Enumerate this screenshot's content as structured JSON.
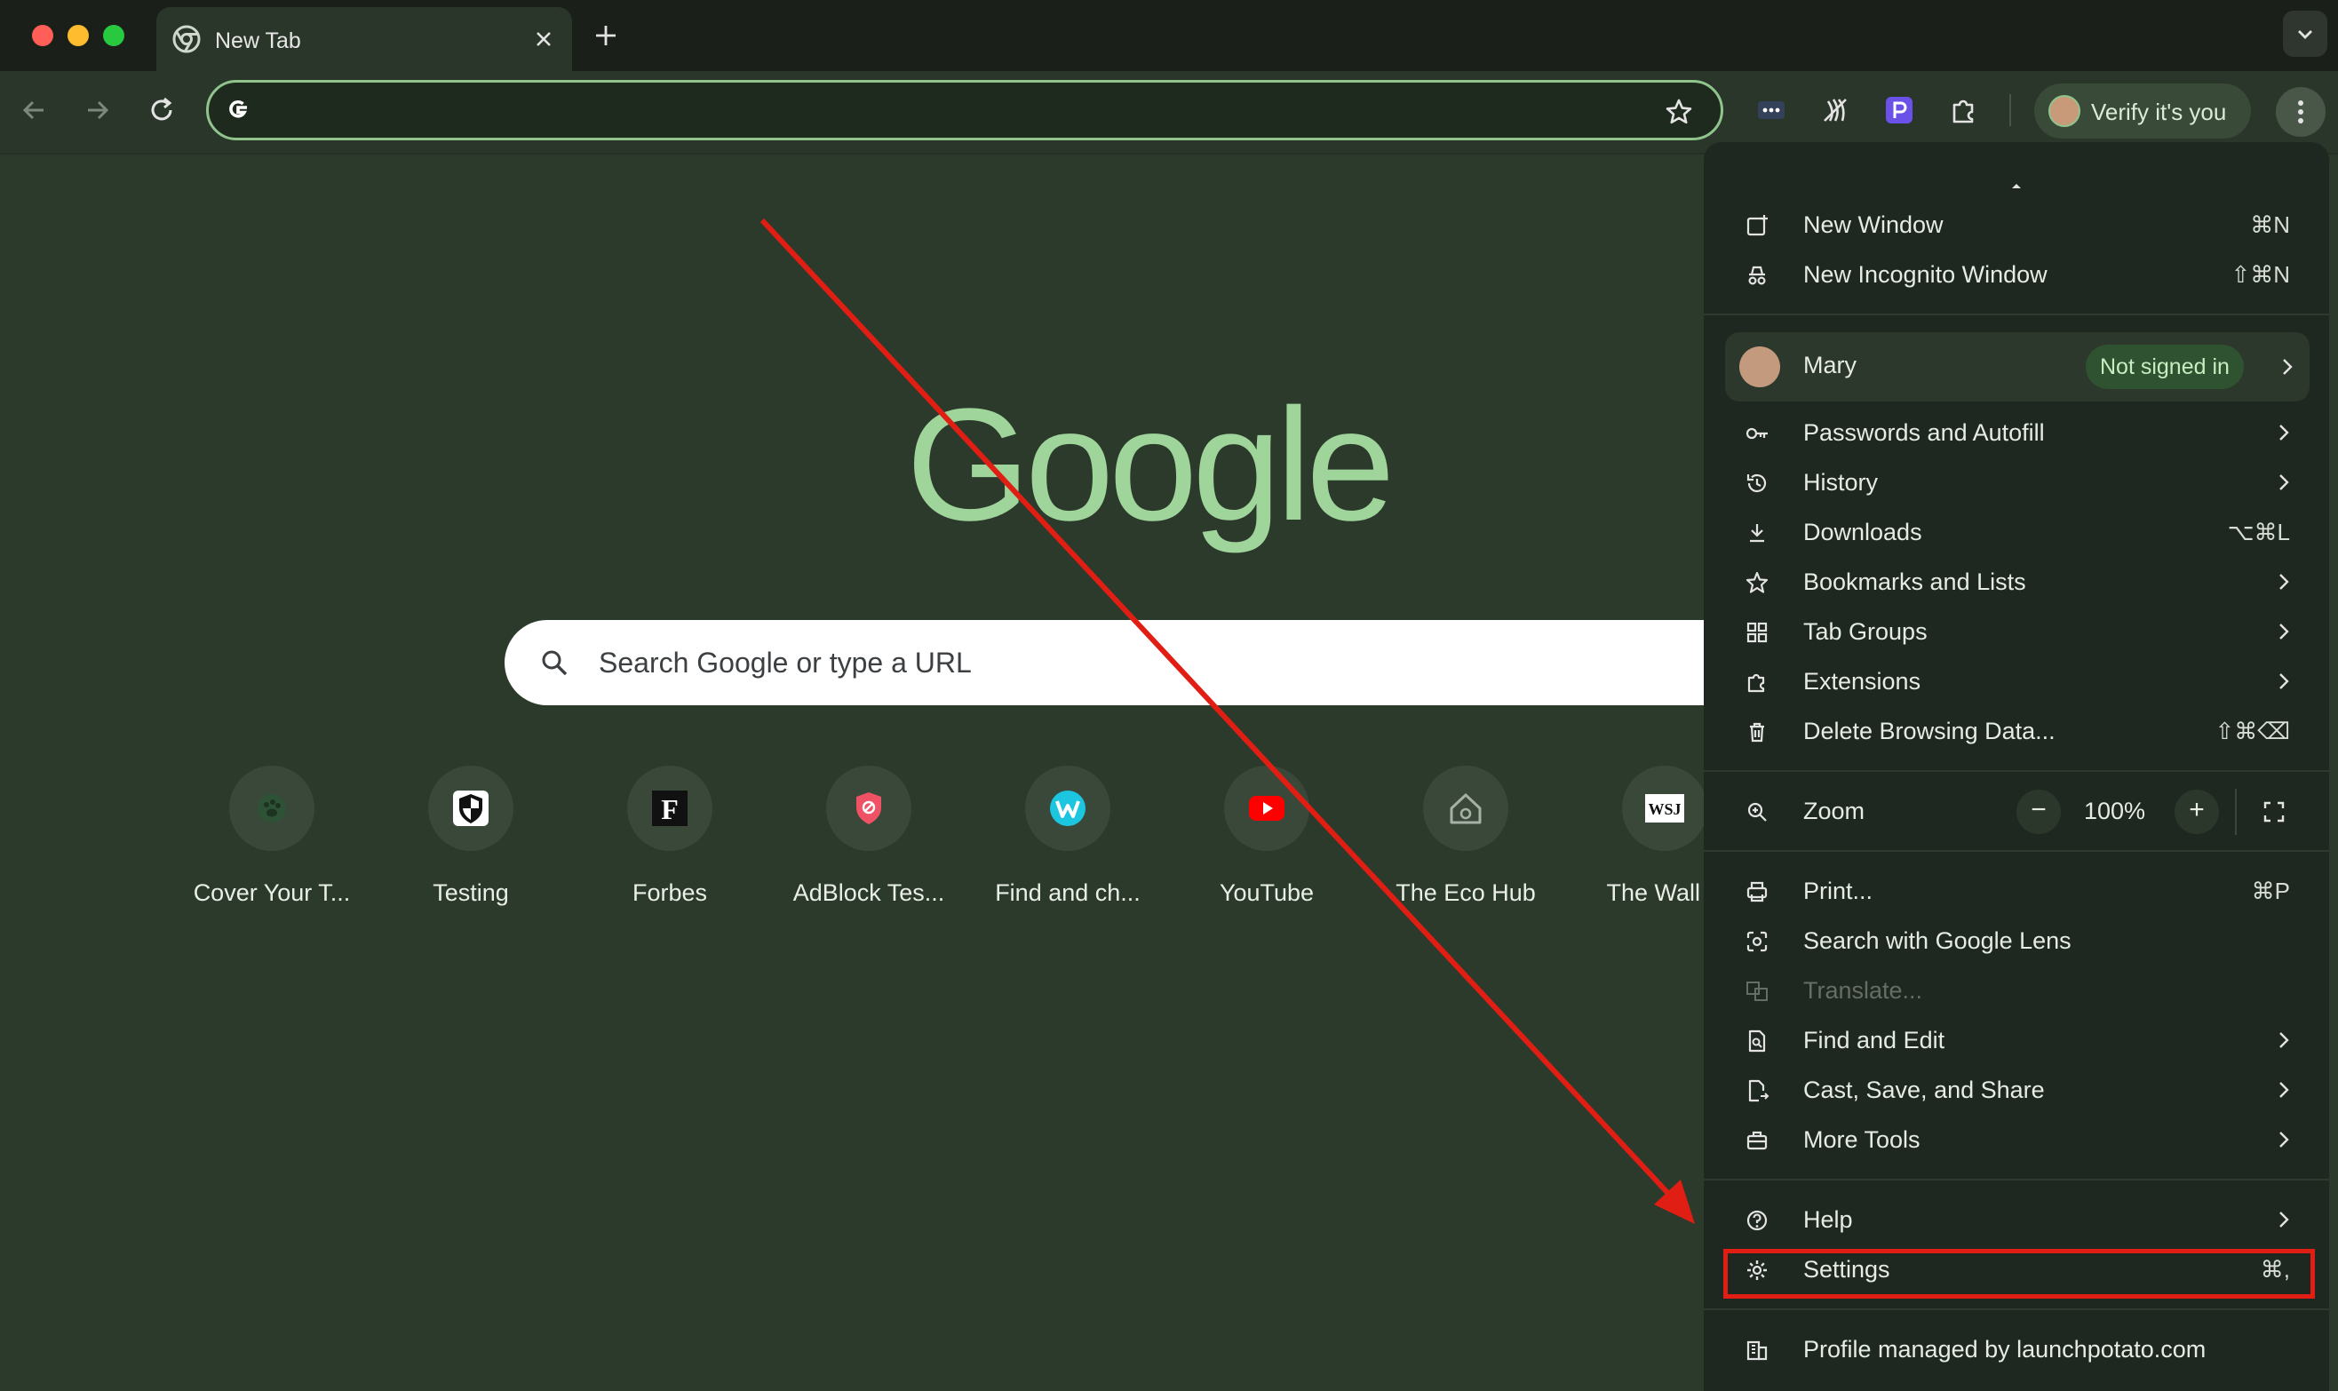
{
  "tab": {
    "title": "New Tab"
  },
  "toolbar": {
    "verify_label": "Verify it's you"
  },
  "ntp": {
    "search_placeholder": "Search Google or type a URL",
    "logo_text": "Google",
    "shortcuts": [
      {
        "label": "Cover Your T...",
        "icon": "paw-icon"
      },
      {
        "label": "Testing",
        "icon": "shield-icon"
      },
      {
        "label": "Forbes",
        "icon": "forbes-icon"
      },
      {
        "label": "AdBlock Tes...",
        "icon": "adblock-icon"
      },
      {
        "label": "Find and ch...",
        "icon": "w-logo-icon"
      },
      {
        "label": "YouTube",
        "icon": "youtube-icon"
      },
      {
        "label": "The Eco Hub",
        "icon": "house-icon"
      },
      {
        "label": "The Wall S",
        "icon": "wsj-icon"
      }
    ]
  },
  "menu": {
    "items": [
      {
        "label": "New Window",
        "shortcut": "⌘N"
      },
      {
        "label": "New Incognito Window",
        "shortcut": "⇧⌘N"
      }
    ],
    "profile": {
      "name": "Mary",
      "status": "Not signed in"
    },
    "group2": [
      {
        "label": "Passwords and Autofill",
        "shortcut": ""
      },
      {
        "label": "History",
        "shortcut": ""
      },
      {
        "label": "Downloads",
        "shortcut": "⌥⌘L"
      },
      {
        "label": "Bookmarks and Lists",
        "shortcut": ""
      },
      {
        "label": "Tab Groups",
        "shortcut": ""
      },
      {
        "label": "Extensions",
        "shortcut": ""
      },
      {
        "label": "Delete Browsing Data...",
        "shortcut": "⇧⌘⌫"
      }
    ],
    "zoom": {
      "label": "Zoom",
      "value": "100%",
      "minus": "−",
      "plus": "+"
    },
    "group3": [
      {
        "label": "Print...",
        "shortcut": "⌘P"
      },
      {
        "label": "Search with Google Lens",
        "shortcut": ""
      },
      {
        "label": "Translate...",
        "shortcut": ""
      },
      {
        "label": "Find and Edit",
        "shortcut": ""
      },
      {
        "label": "Cast, Save, and Share",
        "shortcut": ""
      },
      {
        "label": "More Tools",
        "shortcut": ""
      }
    ],
    "group4": [
      {
        "label": "Help",
        "shortcut": ""
      },
      {
        "label": "Settings",
        "shortcut": "⌘,"
      }
    ],
    "managed": "Profile managed by launchpotato.com"
  },
  "colors": {
    "accent": "#8fc48c",
    "annotation": "#e01e14"
  }
}
